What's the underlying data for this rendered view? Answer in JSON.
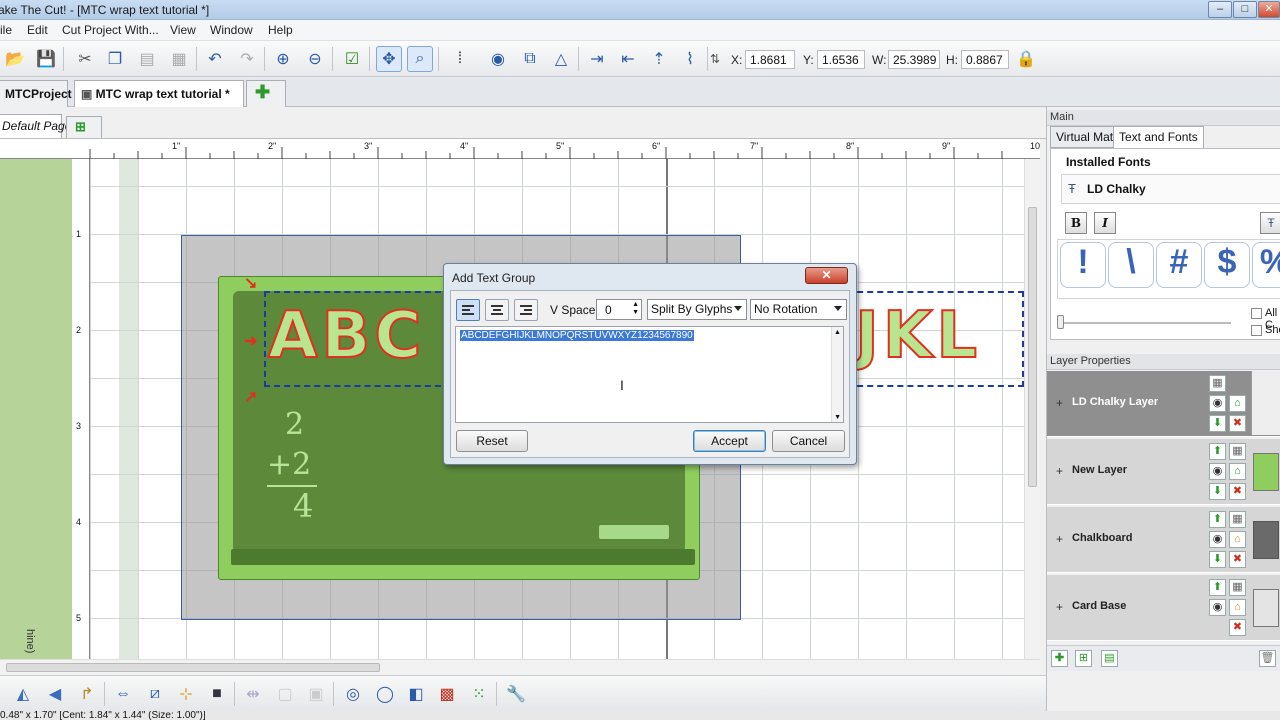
{
  "window": {
    "title": "ake The Cut! - [MTC wrap text tutorial *]",
    "min": "–",
    "max": "□",
    "close": "✕"
  },
  "menu": [
    "ile",
    "Edit",
    "Cut Project With...",
    "View",
    "Window",
    "Help"
  ],
  "coords": {
    "x_label": "X:",
    "x": "1.8681",
    "y_label": "Y:",
    "y": "1.6536",
    "w_label": "W:",
    "w": "25.3989",
    "h_label": "H:",
    "h": "0.8867"
  },
  "tabs": [
    {
      "label": "MTCProject 1"
    },
    {
      "label": "MTC wrap text tutorial *"
    }
  ],
  "page_tab": "Default Page",
  "ruler_top": [
    "1\"",
    "2\"",
    "3\"",
    "4\"",
    "5\"",
    "6\"",
    "7\"",
    "8\"",
    "9\"",
    "10"
  ],
  "ruler_left": [
    "1",
    "2",
    "3",
    "4",
    "5"
  ],
  "left_strip_label": "hine)",
  "canvas_text": {
    "letters_left": "ABC",
    "letters_right": "JKL",
    "math_1": "2",
    "math_2": "+2",
    "math_3": "4"
  },
  "right_panel": {
    "main_title": "Main",
    "tabs": [
      "Virtual Mat",
      "Text and Fonts"
    ],
    "installed_fonts_label": "Installed Fonts",
    "font_name": "LD Chalky",
    "bold": "B",
    "italic": "I",
    "glyphs": [
      "!",
      "\\",
      "#",
      "$",
      "%"
    ],
    "check_1": "All C",
    "check_2": "Sho",
    "layer_props_title": "Layer Properties",
    "layers": [
      {
        "name": "LD Chalky Layer",
        "selected": true
      },
      {
        "name": "New Layer",
        "selected": false
      },
      {
        "name": "Chalkboard",
        "selected": false
      },
      {
        "name": "Card Base",
        "selected": false
      }
    ]
  },
  "dialog": {
    "title": "Add Text Group",
    "vspace_label": "V Space:",
    "vspace_value": "0",
    "split_option": "Split By Glyphs",
    "rotation_option": "No Rotation",
    "text": "ABCDEFGHIJKLMNOPQRSTUVWXYZ1234567890",
    "reset": "Reset",
    "accept": "Accept",
    "cancel": "Cancel"
  },
  "status": "0.48\" x 1.70\" [Cent: 1.84\" x 1.44\" (Size: 1.00\")]",
  "colors": {
    "chalkboard_frame": "#8fce5e",
    "chalkboard": "#5d8a3a",
    "selection": "#1a3aa8",
    "accent_red": "#e03020"
  }
}
